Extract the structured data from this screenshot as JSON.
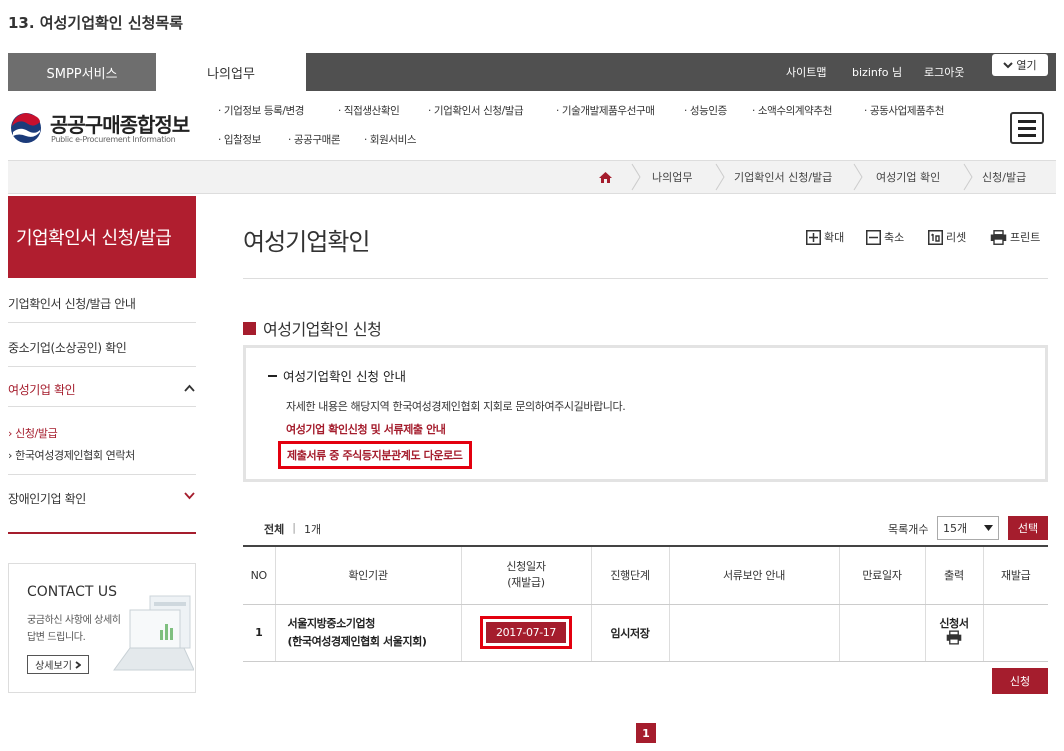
{
  "caption": "13. 여성기업확인 신청목록",
  "topbar": {
    "tab_smpp": "SMPP서비스",
    "tab_mywork": "나의업무",
    "sitemap": "사이트맵",
    "user": "bizinfo 님",
    "logout": "로그아웃",
    "open": "열기"
  },
  "logo": {
    "name": "공공구매종합정보",
    "sub": "Public e-Procurement Information"
  },
  "gnb": {
    "row1": [
      "· 기업정보 등록/변경",
      "· 직접생산확인",
      "· 기업확인서 신청/발급",
      "· 기술개발제품우선구매",
      "· 성능인증",
      "· 소액수의계약추천",
      "· 공동사업제품추천"
    ],
    "row2": [
      "· 입찰정보",
      "· 공공구매론",
      "· 회원서비스"
    ]
  },
  "breadcrumb": [
    "나의업무",
    "기업확인서 신청/발급",
    "여성기업 확인",
    "신청/발급"
  ],
  "lnb": {
    "title": "기업확인서 신청/발급",
    "items": [
      "기업확인서 신청/발급 안내",
      "중소기업(소상공인) 확인",
      "여성기업 확인",
      "장애인기업 확인"
    ],
    "subs": [
      "신청/발급",
      "한국여성경제인협회 연락처"
    ]
  },
  "contact": {
    "title": "CONTACT US",
    "line1": "궁금하신 사항에 상세히",
    "line2": "답변 드립니다.",
    "button": "상세보기"
  },
  "main": {
    "title": "여성기업확인",
    "tools": [
      "확대",
      "축소",
      "리셋",
      "프린트"
    ],
    "section_title": "여성기업확인 신청",
    "guide_head": "여성기업확인 신청 안내",
    "guide_text": "자세한 내용은 해당지역 한국여성경제인협회 지회로 문의하여주시길바랍니다.",
    "guide_link1": "여성기업 확인신청 및 서류제출 안내",
    "guide_link2": "제출서류 중 주식등지분관계도 다운로드",
    "total_label": "전체",
    "total_count": "1개",
    "per_label": "목록개수",
    "per_value": "15개",
    "select_button": "선택",
    "apply_button": "신청",
    "page": "1"
  },
  "table": {
    "headers": [
      "NO",
      "확인기관",
      "신청일자\n(재발급)",
      "진행단계",
      "서류보안 안내",
      "만료일자",
      "출력",
      "재발급"
    ],
    "row": {
      "no": "1",
      "org1": "서울지방중소기업청",
      "org2": "(한국여성경제인협회 서울지회)",
      "date": "2017-07-17",
      "stage": "임시저장",
      "doc": "",
      "expire": "",
      "print": "신청서",
      "reissue": ""
    }
  },
  "colors": {
    "brand": "#a51d2d",
    "highlight": "#e3000f",
    "topbar": "#505050"
  }
}
